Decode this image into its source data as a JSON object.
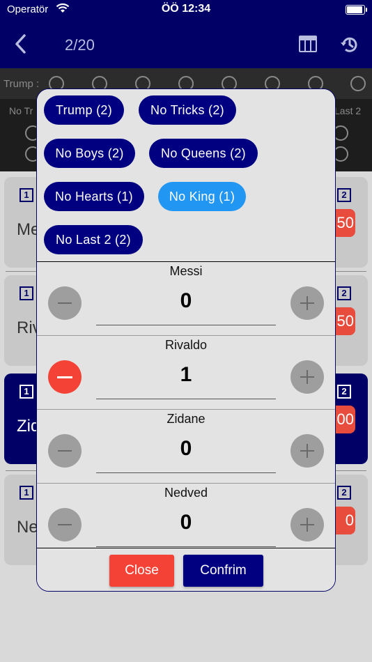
{
  "status_bar": {
    "carrier": "Operatör",
    "time": "ÖÖ 12:34"
  },
  "nav": {
    "counter": "2/20",
    "icons": [
      "back-chevron-icon",
      "table-icon",
      "history-icon"
    ]
  },
  "trump_strip": {
    "trump_label": "Trump :",
    "labels": [
      "No Tr",
      "Last 2"
    ]
  },
  "background_cards": [
    {
      "badge_left": "1",
      "badge_right": "2",
      "name": "Me",
      "score": "50"
    },
    {
      "badge_left": "1",
      "badge_right": "2",
      "name": "Riv",
      "score": "50"
    },
    {
      "badge_left": "1",
      "badge_right": "2",
      "name": "Zid",
      "score": "00"
    },
    {
      "badge_left": "1",
      "badge_right": "2",
      "name": "Ne",
      "score": "0"
    }
  ],
  "modal": {
    "game_types": [
      {
        "label": "Trump (2)",
        "selected": false
      },
      {
        "label": "No Tricks (2)",
        "selected": false
      },
      {
        "label": "No Boys (2)",
        "selected": false
      },
      {
        "label": "No Queens (2)",
        "selected": false
      },
      {
        "label": "No Hearts (1)",
        "selected": false
      },
      {
        "label": "No King (1)",
        "selected": true
      },
      {
        "label": "No Last 2 (2)",
        "selected": false
      }
    ],
    "players": [
      {
        "name": "Messi",
        "value": "0",
        "minus_active": false
      },
      {
        "name": "Rivaldo",
        "value": "1",
        "minus_active": true
      },
      {
        "name": "Zidane",
        "value": "0",
        "minus_active": false
      },
      {
        "name": "Nedved",
        "value": "0",
        "minus_active": false
      }
    ],
    "close_label": "Close",
    "confirm_label": "Confrim"
  },
  "colors": {
    "navy": "#000066",
    "chip": "#000080",
    "chip_selected": "#2196f3",
    "danger": "#f44336",
    "neutral_button": "#9e9e9e"
  }
}
